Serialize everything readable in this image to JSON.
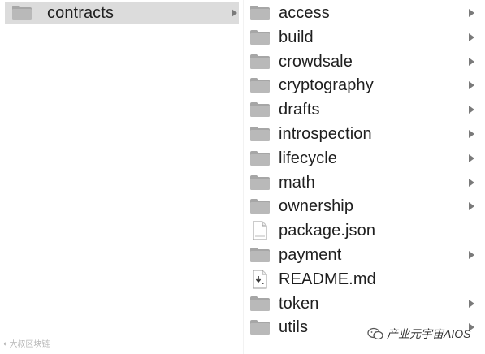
{
  "left_column": {
    "items": [
      {
        "label": "contracts",
        "type": "folder",
        "selected": true,
        "expandable": true
      }
    ]
  },
  "right_column": {
    "items": [
      {
        "label": "access",
        "type": "folder",
        "expandable": true
      },
      {
        "label": "build",
        "type": "folder",
        "expandable": true
      },
      {
        "label": "crowdsale",
        "type": "folder",
        "expandable": true
      },
      {
        "label": "cryptography",
        "type": "folder",
        "expandable": true
      },
      {
        "label": "drafts",
        "type": "folder",
        "expandable": true
      },
      {
        "label": "introspection",
        "type": "folder",
        "expandable": true
      },
      {
        "label": "lifecycle",
        "type": "folder",
        "expandable": true
      },
      {
        "label": "math",
        "type": "folder",
        "expandable": true
      },
      {
        "label": "ownership",
        "type": "folder",
        "expandable": true
      },
      {
        "label": "package.json",
        "type": "json-file",
        "expandable": false
      },
      {
        "label": "payment",
        "type": "folder",
        "expandable": true
      },
      {
        "label": "README.md",
        "type": "md-file",
        "expandable": false
      },
      {
        "label": "token",
        "type": "folder",
        "expandable": true
      },
      {
        "label": "utils",
        "type": "folder",
        "expandable": true
      }
    ]
  },
  "watermarks": {
    "left": "大叔区块链",
    "right": "产业元宇宙AIOS"
  },
  "colors": {
    "selection": "#dcdcdc",
    "folder_fill": "#b9b9b9",
    "folder_tab": "#a6a6a6",
    "chevron": "#7a7a7a"
  }
}
